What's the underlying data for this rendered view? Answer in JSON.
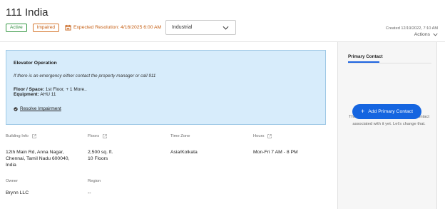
{
  "header": {
    "title": "111 India",
    "badges": {
      "active": "Active",
      "impaired": "Impaired"
    },
    "resolution": "Expected Resolution: 4/16/2025 6:00 AM",
    "type_select": "Industrial",
    "created": "Created 12/19/2022, 7:10 AM",
    "actions": "Actions"
  },
  "alert": {
    "title": "Elevator Operation",
    "message": "If there is an emergency either contact the property manager or call 911",
    "floor_label": "Floor / Space:",
    "floor_value": " 1st Floor, + 1 More..",
    "equipment_label": "Equipment:",
    "equipment_value": " AHU 11",
    "resolve": "Resolve Impairment"
  },
  "info": {
    "building_info": {
      "label": "Building Info",
      "lines": [
        "12th Main Rd, Anna Nagar,",
        "Chennai, Tamil Nadu 600040,",
        "India"
      ]
    },
    "floors": {
      "label": "Floors",
      "lines": [
        "2,500 sq. ft.",
        "10 Floors"
      ]
    },
    "time_zone": {
      "label": "Time Zone",
      "lines": [
        "Asia/Kolkata"
      ]
    },
    "hours": {
      "label": "Hours",
      "lines": [
        "Mon-Fri 7 AM - 8 PM"
      ]
    },
    "owner": {
      "label": "Owner",
      "lines": [
        "Brynn LLC"
      ]
    },
    "region": {
      "label": "Region",
      "lines": [
        "--"
      ]
    }
  },
  "sidebar": {
    "tab": "Primary Contact",
    "message": "This building doesn't have a primary contact associated with it yet. Let's change that.",
    "button": "Add Primary Contact"
  },
  "colors": {
    "accent": "#1565e0",
    "active": "#2e8b3c",
    "impaired": "#c65f14",
    "alert_bg": "#d7ecfb"
  }
}
